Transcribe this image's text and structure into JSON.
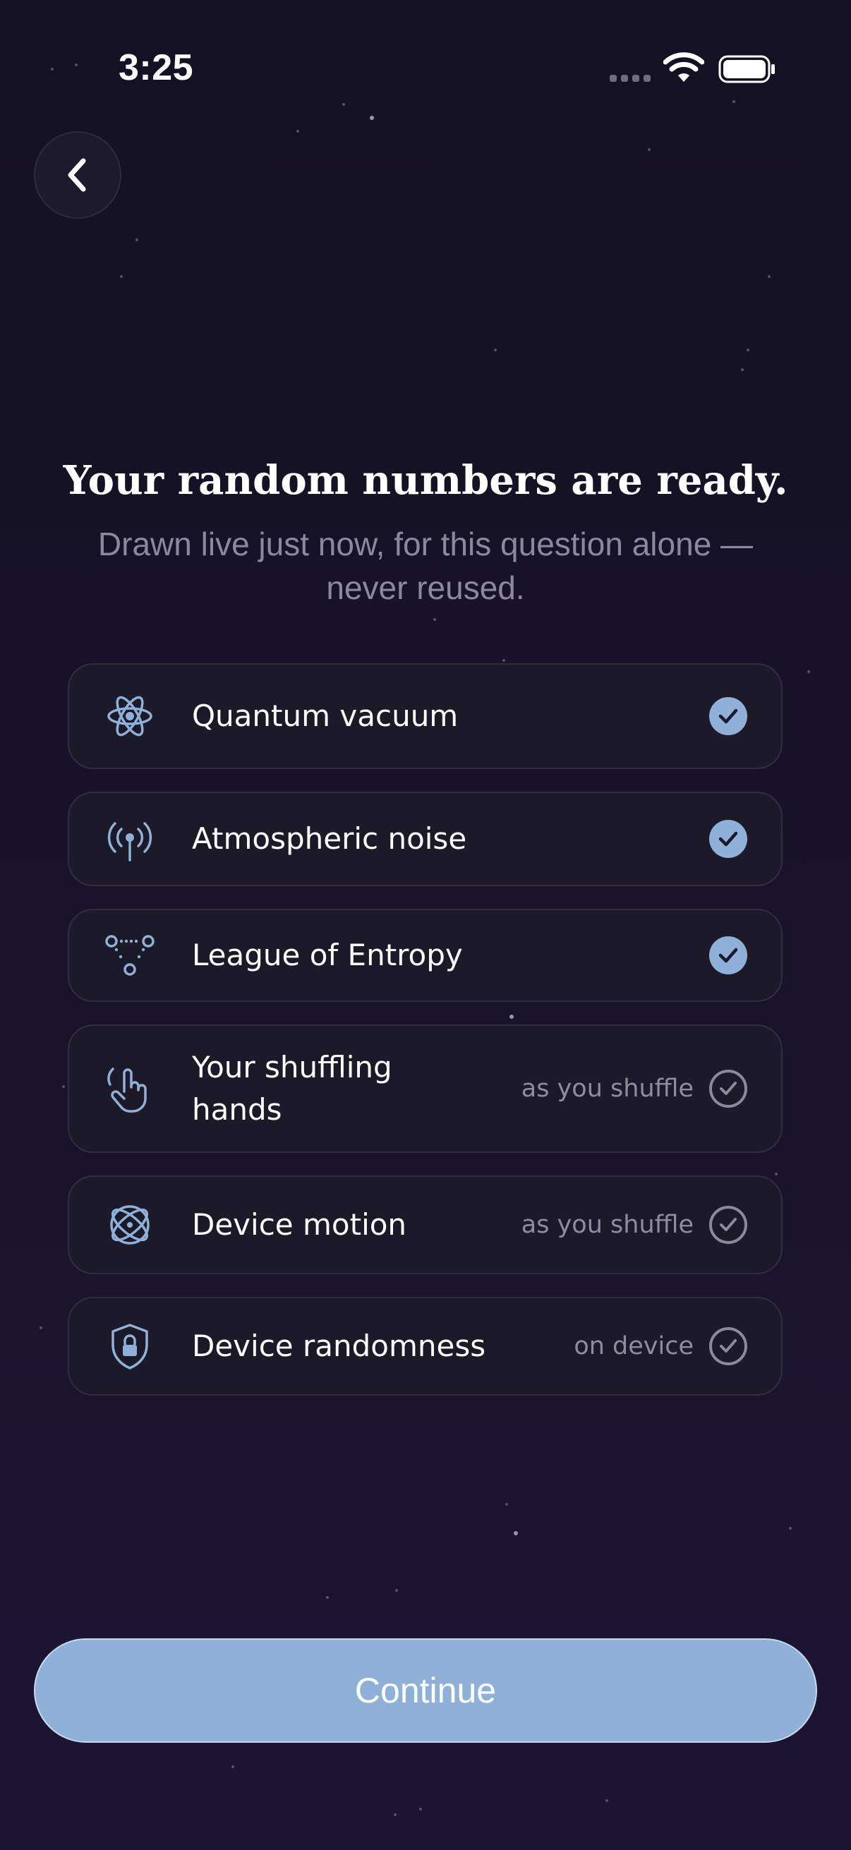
{
  "status_bar": {
    "time": "3:25"
  },
  "header": {
    "back_icon": "chevron-left-icon"
  },
  "main": {
    "title": "Your random numbers are ready.",
    "subtitle": "Drawn live just now, for this question alone — never reused."
  },
  "sources": [
    {
      "label": "Quantum vacuum",
      "icon": "atom-icon",
      "note": "",
      "status": "checked"
    },
    {
      "label": "Atmospheric noise",
      "icon": "antenna-icon",
      "note": "",
      "status": "checked"
    },
    {
      "label": "League of Entropy",
      "icon": "network-nodes-icon",
      "note": "",
      "status": "checked"
    },
    {
      "label": "Your shuffling hands",
      "icon": "hand-pointer-icon",
      "note": "as you shuffle",
      "status": "pending"
    },
    {
      "label": "Device motion",
      "icon": "motion-gyro-icon",
      "note": "as you shuffle",
      "status": "pending"
    },
    {
      "label": "Device randomness",
      "icon": "lock-shield-icon",
      "note": "on device",
      "status": "pending"
    }
  ],
  "footer": {
    "continue_label": "Continue"
  },
  "colors": {
    "background": "#171226",
    "card": "#1c1929",
    "accent": "#8fb1d9",
    "muted_text": "#8c889e"
  }
}
